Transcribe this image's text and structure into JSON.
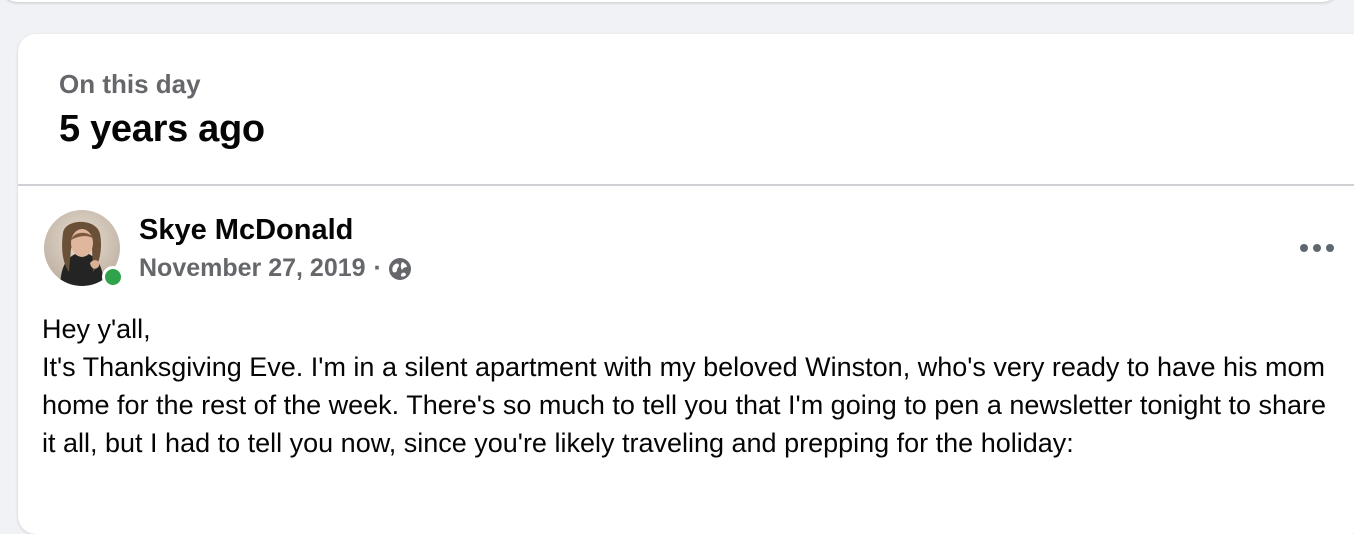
{
  "memory": {
    "label": "On this day",
    "years_ago": "5 years ago"
  },
  "post": {
    "author": "Skye McDonald",
    "date": "November 27, 2019",
    "separator": "·",
    "privacy_icon": "globe-icon",
    "more_icon": "more-options-icon",
    "online_status_color": "#31a24c",
    "text": "Hey y'all,\nIt's Thanksgiving Eve. I'm in a silent apartment with my beloved Winston, who's very ready to have his mom home for the rest of the week. There's so much to tell you that I'm going to pen a newsletter tonight to share it all, but I had to tell you now, since you're likely traveling and prepping for the holiday:"
  }
}
